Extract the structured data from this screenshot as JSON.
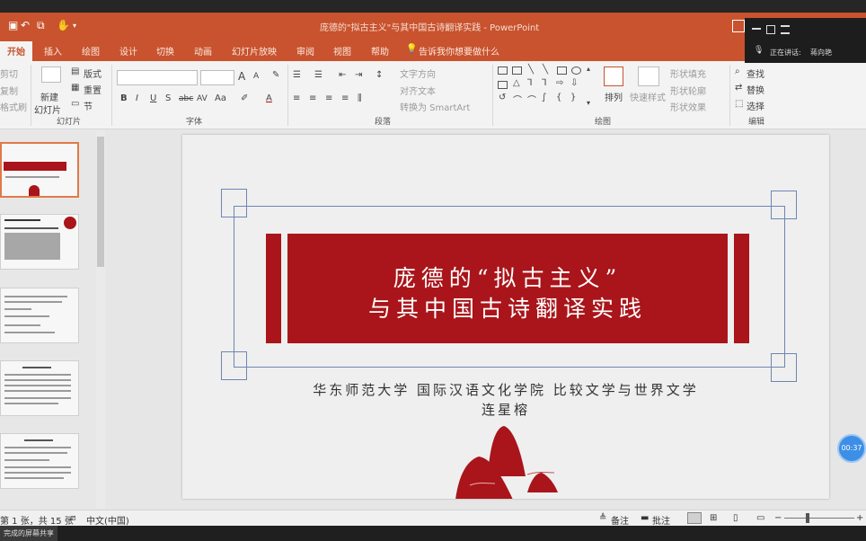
{
  "window": {
    "title": "庞德的\"拟古主义\"与其中国古诗翻译实践 - PowerPoint"
  },
  "ribbon_tabs": [
    "开始",
    "插入",
    "绘图",
    "设计",
    "切换",
    "动画",
    "幻灯片放映",
    "审阅",
    "视图",
    "帮助"
  ],
  "tell_me": "告诉我你想要做什么",
  "ribbon": {
    "clipboard": {
      "cut": "剪切",
      "copy": "复制",
      "format_painter": "格式刷"
    },
    "slides": {
      "new_slide_1": "新建",
      "new_slide_2": "幻灯片",
      "layout": "版式",
      "reset": "重置",
      "section": "节",
      "label": "幻灯片"
    },
    "font": {
      "label": "字体",
      "bold": "B",
      "italic": "I",
      "underline": "U",
      "strike": "S",
      "abc": "abc",
      "av": "AV",
      "aa": "Aa",
      "font_color": "A",
      "grow": "A",
      "shrink": "A"
    },
    "paragraph": {
      "label": "段落",
      "text_direction": "文字方向",
      "align_text": "对齐文本",
      "convert_smartart": "转换为 SmartArt"
    },
    "drawing": {
      "label": "绘图",
      "arrange": "排列",
      "quick_styles": "快速样式",
      "shape_fill": "形状填充",
      "shape_outline": "形状轮廓",
      "shape_effects": "形状效果"
    },
    "editing": {
      "label": "编辑",
      "find": "查找",
      "replace": "替换",
      "select": "选择"
    }
  },
  "overlay": {
    "presenting": "正在讲话:",
    "name": "蒋向艳"
  },
  "slide": {
    "title_line1": "庞德的“拟古主义”",
    "title_line2": "与其中国古诗翻译实践",
    "affiliation": "华东师范大学  国际汉语文化学院  比较文学与世界文学",
    "author": "连星榕"
  },
  "thumbnails": [
    {
      "num": "1",
      "selected": true
    },
    {
      "num": "2",
      "selected": false
    },
    {
      "num": "3",
      "selected": false
    },
    {
      "num": "4",
      "selected": false
    },
    {
      "num": "5",
      "selected": false
    }
  ],
  "status": {
    "slide_count": "第 1 张，共 15 张",
    "language": "中文(中国)",
    "notes": "备注",
    "comments": "批注"
  },
  "timer": "00:37",
  "taskbar": {
    "item": "完成的屏幕共享"
  },
  "colors": {
    "accent": "#c8532e",
    "slide_red": "#a9151a",
    "frame_blue": "#6d86b4"
  }
}
